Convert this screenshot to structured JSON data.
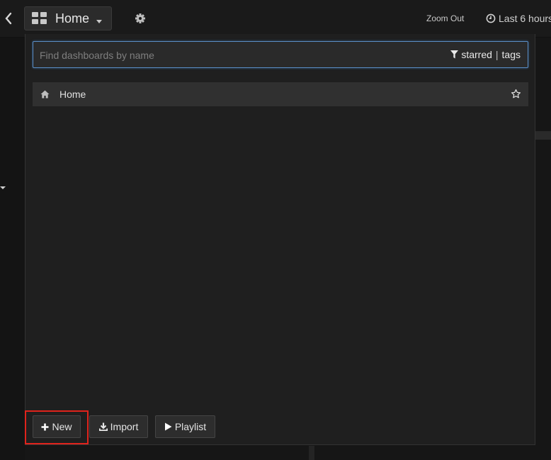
{
  "topbar": {
    "dashboard_title": "Home",
    "zoom_out_label": "Zoom Out",
    "time_range_label": "Last 6 hours"
  },
  "search": {
    "placeholder": "Find dashboards by name",
    "value": "",
    "filter_starred": "starred",
    "filter_separator": "|",
    "filter_tags": "tags"
  },
  "results": [
    {
      "label": "Home",
      "icon": "home-icon",
      "starred": false
    }
  ],
  "footer": {
    "new_label": "New",
    "import_label": "Import",
    "playlist_label": "Playlist"
  },
  "colors": {
    "highlight": "#e0231c",
    "focus_border": "#5a8ec6"
  }
}
